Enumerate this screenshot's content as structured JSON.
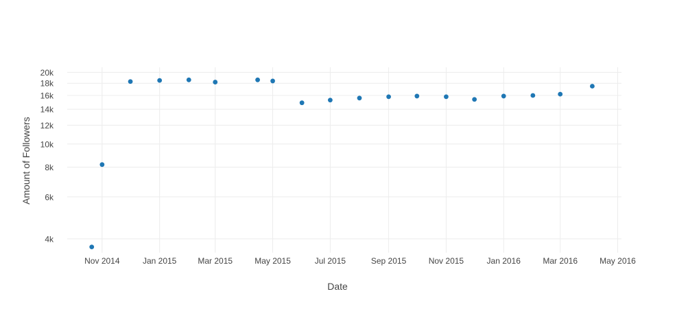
{
  "chart_data": {
    "type": "scatter",
    "xlabel": "Date",
    "ylabel": "Amount of Followers",
    "x_range": [
      "2014-09-25",
      "2016-05-05"
    ],
    "y_range": [
      3500,
      21000
    ],
    "y_scale": "log",
    "grid": true,
    "legend": "none",
    "marker_color": "#1f77b4",
    "x_ticks": [
      {
        "date": "2014-11-01",
        "label": "Nov 2014"
      },
      {
        "date": "2015-01-01",
        "label": "Jan 2015"
      },
      {
        "date": "2015-03-01",
        "label": "Mar 2015"
      },
      {
        "date": "2015-05-01",
        "label": "May 2015"
      },
      {
        "date": "2015-07-01",
        "label": "Jul 2015"
      },
      {
        "date": "2015-09-01",
        "label": "Sep 2015"
      },
      {
        "date": "2015-11-01",
        "label": "Nov 2015"
      },
      {
        "date": "2016-01-01",
        "label": "Jan 2016"
      },
      {
        "date": "2016-03-01",
        "label": "Mar 2016"
      },
      {
        "date": "2016-05-01",
        "label": "May 2016"
      }
    ],
    "y_ticks": [
      {
        "value": 4000,
        "label": "4k"
      },
      {
        "value": 6000,
        "label": "6k"
      },
      {
        "value": 8000,
        "label": "8k"
      },
      {
        "value": 10000,
        "label": "10k"
      },
      {
        "value": 12000,
        "label": "12k"
      },
      {
        "value": 14000,
        "label": "14k"
      },
      {
        "value": 16000,
        "label": "16k"
      },
      {
        "value": 18000,
        "label": "18k"
      },
      {
        "value": 20000,
        "label": "20k"
      }
    ],
    "points": [
      {
        "x": "2014-10-21",
        "y": 3700
      },
      {
        "x": "2014-11-01",
        "y": 8200
      },
      {
        "x": "2014-12-01",
        "y": 18300
      },
      {
        "x": "2015-01-01",
        "y": 18500
      },
      {
        "x": "2015-02-01",
        "y": 18600
      },
      {
        "x": "2015-03-01",
        "y": 18200
      },
      {
        "x": "2015-04-15",
        "y": 18600
      },
      {
        "x": "2015-05-01",
        "y": 18400
      },
      {
        "x": "2015-06-01",
        "y": 14900
      },
      {
        "x": "2015-07-01",
        "y": 15300
      },
      {
        "x": "2015-08-01",
        "y": 15600
      },
      {
        "x": "2015-09-01",
        "y": 15800
      },
      {
        "x": "2015-10-01",
        "y": 15900
      },
      {
        "x": "2015-11-01",
        "y": 15800
      },
      {
        "x": "2015-12-01",
        "y": 15400
      },
      {
        "x": "2016-01-01",
        "y": 15900
      },
      {
        "x": "2016-02-01",
        "y": 16000
      },
      {
        "x": "2016-03-01",
        "y": 16200
      },
      {
        "x": "2016-04-04",
        "y": 17500
      }
    ]
  }
}
